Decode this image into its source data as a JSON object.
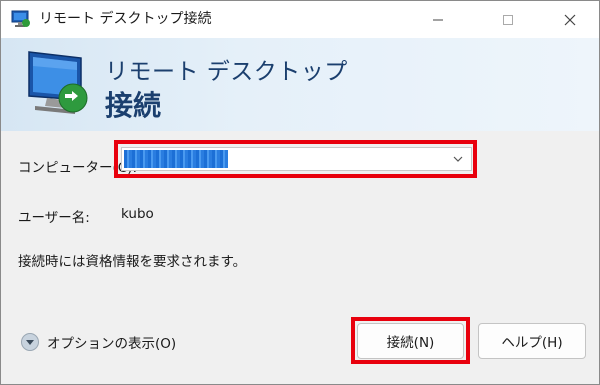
{
  "window": {
    "title": "リモート デスクトップ接続",
    "minimize_glyph": "—",
    "maximize_glyph": "☐",
    "close_glyph": "✕"
  },
  "banner": {
    "line1": "リモート デスクトップ",
    "line2": "接続"
  },
  "form": {
    "computer_label": "コンピューター(C):",
    "computer_value": "",
    "username_label": "ユーザー名:",
    "username_value": "kubo",
    "credentials_note": "接続時には資格情報を要求されます。"
  },
  "footer": {
    "options_label": "オプションの表示(O)",
    "connect_button": "接続(N)",
    "help_button": "ヘルプ(H)"
  },
  "icons": {
    "app": "remote-desktop-icon",
    "banner": "monitor-connection-icon",
    "dropdown": "chevron-down-icon",
    "options": "expand-circle-icon"
  },
  "colors": {
    "highlight": "#e8000d",
    "banner_text": "#1b3f6e",
    "selection": "#1c6fd6"
  }
}
